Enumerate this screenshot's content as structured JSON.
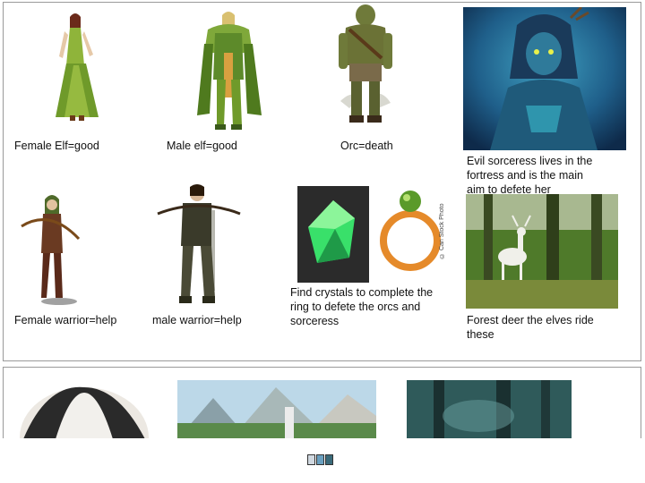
{
  "slide1": {
    "captions": {
      "female_elf": "Female Elf=good",
      "male_elf": "Male elf=good",
      "orc": "Orc=death",
      "sorceress": "Evil sorceress lives in the fortress and is the main aim to defete her",
      "female_warrior": "Female warrior=help",
      "male_warrior": "male warrior=help",
      "crystals": "Find crystals to complete the ring to defete the orcs and sorceress",
      "deer": "Forest deer the elves ride these"
    },
    "watermark": "© Can Stock Photo"
  },
  "colors": {
    "slide_border": "#9a9a9a",
    "elf_green": "#6f9a2a",
    "crystal_green": "#39e06a",
    "ring_orange": "#e58a2a",
    "sorceress_blue": "#1f6f9a",
    "forest_green": "#4f7a2a"
  }
}
